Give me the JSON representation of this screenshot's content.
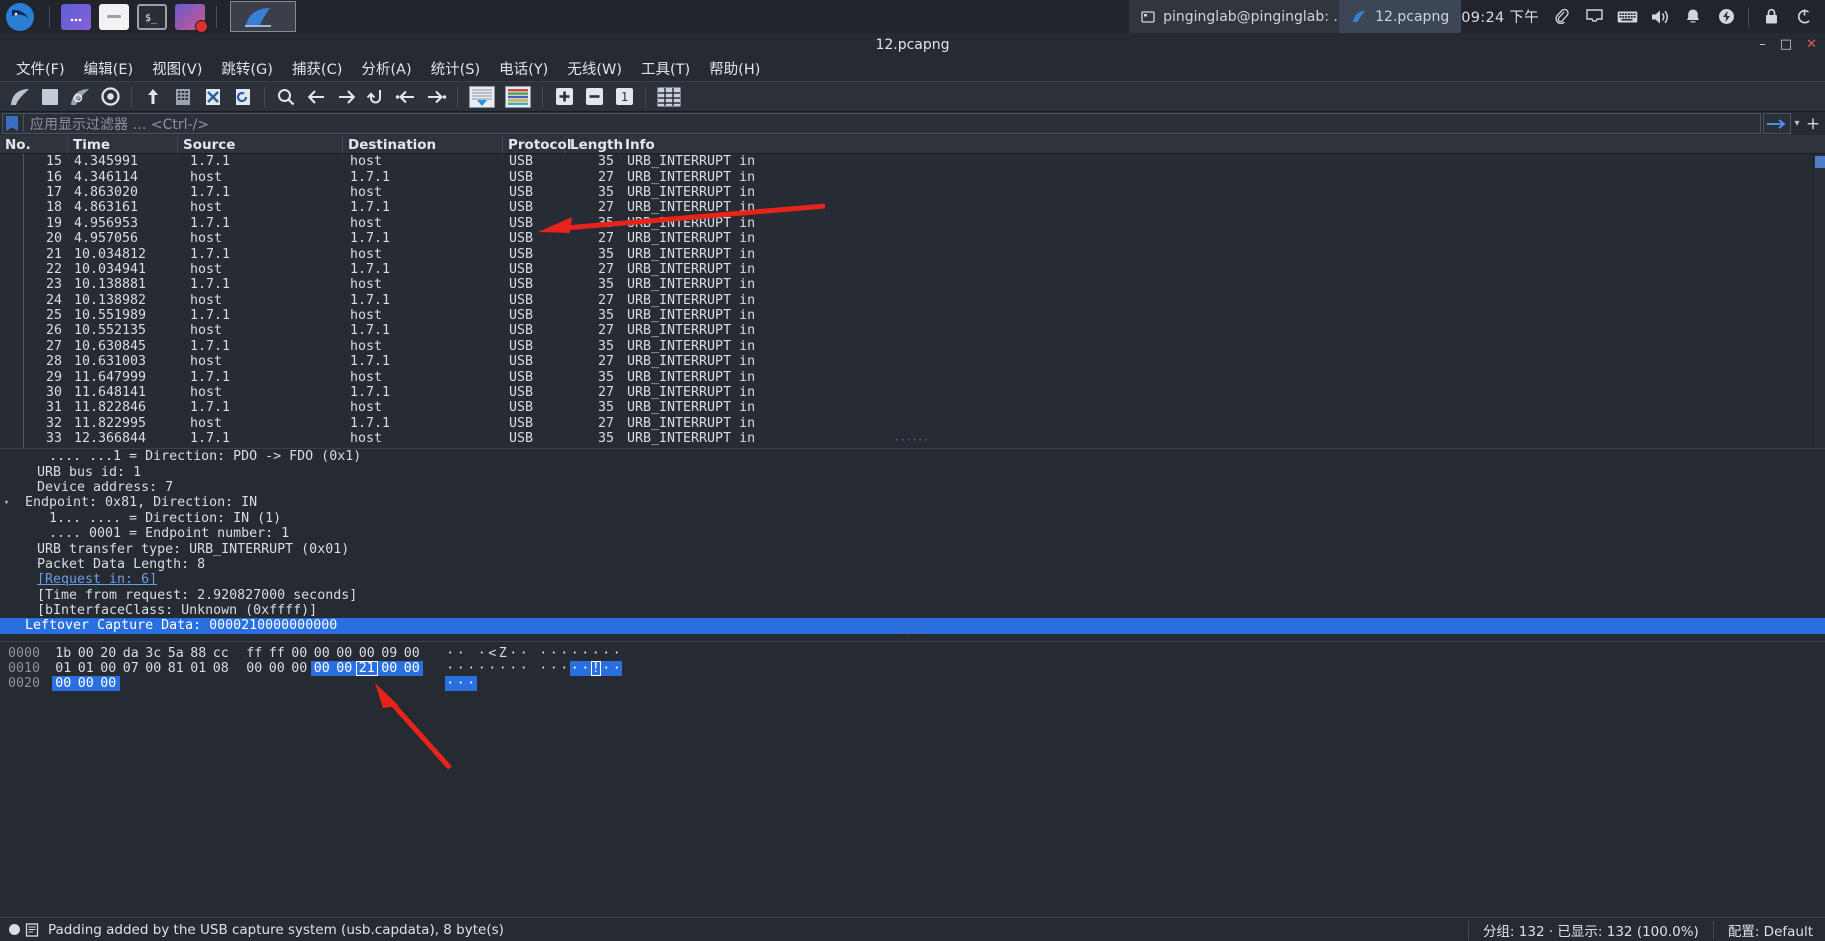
{
  "taskbar": {
    "launchers": [
      {
        "name": "kali-logo-icon"
      },
      {
        "name": "files-icon"
      },
      {
        "name": "folder-icon"
      },
      {
        "name": "terminal-icon"
      },
      {
        "name": "screen-recorder-icon"
      }
    ],
    "active_app": "wireshark-icon",
    "tasks": [
      {
        "label": "pinginglab@pinginglab: ...",
        "icon": "terminal-icon"
      },
      {
        "label": "12.pcapng",
        "icon": "wireshark-icon"
      }
    ],
    "clock": "09:24 下午",
    "tray": [
      {
        "name": "clipboard-icon",
        "glyph": "🖈"
      },
      {
        "name": "display-icon"
      },
      {
        "name": "keyboard-icon"
      },
      {
        "name": "volume-icon"
      },
      {
        "name": "notification-bell-icon"
      },
      {
        "name": "power-bolt-icon"
      },
      {
        "name": "lock-icon"
      },
      {
        "name": "logout-icon"
      }
    ]
  },
  "window": {
    "title": "12.pcapng",
    "minimize": "–",
    "maximize": "□",
    "close": "✕"
  },
  "menu": [
    {
      "label": "文件(F)",
      "key": "F"
    },
    {
      "label": "编辑(E)",
      "key": "E"
    },
    {
      "label": "视图(V)",
      "key": "V"
    },
    {
      "label": "跳转(G)",
      "key": "G"
    },
    {
      "label": "捕获(C)",
      "key": "C"
    },
    {
      "label": "分析(A)",
      "key": "A"
    },
    {
      "label": "统计(S)",
      "key": "S"
    },
    {
      "label": "电话(Y)",
      "key": "Y"
    },
    {
      "label": "无线(W)",
      "key": "W"
    },
    {
      "label": "工具(T)",
      "key": "T"
    },
    {
      "label": "帮助(H)",
      "key": "H"
    }
  ],
  "toolbar": [
    {
      "name": "start-capture-icon"
    },
    {
      "name": "stop-capture-icon"
    },
    {
      "name": "restart-capture-icon"
    },
    {
      "name": "capture-options-icon"
    },
    {
      "name": "open-file-icon"
    },
    {
      "name": "save-file-icon"
    },
    {
      "name": "close-file-icon"
    },
    {
      "name": "reload-file-icon"
    },
    {
      "name": "find-packet-icon"
    },
    {
      "name": "go-back-icon"
    },
    {
      "name": "go-forward-icon"
    },
    {
      "name": "go-to-packet-icon"
    },
    {
      "name": "go-to-first-packet-icon"
    },
    {
      "name": "go-to-last-packet-icon"
    },
    {
      "name": "auto-scroll-icon"
    },
    {
      "name": "colorize-icon"
    },
    {
      "name": "zoom-in-icon"
    },
    {
      "name": "zoom-out-icon"
    },
    {
      "name": "zoom-reset-icon"
    },
    {
      "name": "resize-columns-icon"
    }
  ],
  "filter": {
    "placeholder": "应用显示过滤器 … <Ctrl-/>",
    "value": "",
    "bookmark_icon": "filter-bookmark-icon",
    "apply_icon": "apply-filter-arrow-icon",
    "dropdown_icon": "chevron-down-icon",
    "add_icon": "add-filter-button"
  },
  "packet_list": {
    "columns": [
      "No.",
      "Time",
      "Source",
      "Destination",
      "Protocol",
      "Length",
      "Info"
    ],
    "rows": [
      {
        "no": "15",
        "time": "4.345991",
        "src": "1.7.1",
        "dst": "host",
        "proto": "USB",
        "len": "35",
        "info": "URB_INTERRUPT in"
      },
      {
        "no": "16",
        "time": "4.346114",
        "src": "host",
        "dst": "1.7.1",
        "proto": "USB",
        "len": "27",
        "info": "URB_INTERRUPT in"
      },
      {
        "no": "17",
        "time": "4.863020",
        "src": "1.7.1",
        "dst": "host",
        "proto": "USB",
        "len": "35",
        "info": "URB_INTERRUPT in"
      },
      {
        "no": "18",
        "time": "4.863161",
        "src": "host",
        "dst": "1.7.1",
        "proto": "USB",
        "len": "27",
        "info": "URB_INTERRUPT in"
      },
      {
        "no": "19",
        "time": "4.956953",
        "src": "1.7.1",
        "dst": "host",
        "proto": "USB",
        "len": "35",
        "info": "URB_INTERRUPT in"
      },
      {
        "no": "20",
        "time": "4.957056",
        "src": "host",
        "dst": "1.7.1",
        "proto": "USB",
        "len": "27",
        "info": "URB_INTERRUPT in"
      },
      {
        "no": "21",
        "time": "10.034812",
        "src": "1.7.1",
        "dst": "host",
        "proto": "USB",
        "len": "35",
        "info": "URB_INTERRUPT in"
      },
      {
        "no": "22",
        "time": "10.034941",
        "src": "host",
        "dst": "1.7.1",
        "proto": "USB",
        "len": "27",
        "info": "URB_INTERRUPT in"
      },
      {
        "no": "23",
        "time": "10.138881",
        "src": "1.7.1",
        "dst": "host",
        "proto": "USB",
        "len": "35",
        "info": "URB_INTERRUPT in"
      },
      {
        "no": "24",
        "time": "10.138982",
        "src": "host",
        "dst": "1.7.1",
        "proto": "USB",
        "len": "27",
        "info": "URB_INTERRUPT in"
      },
      {
        "no": "25",
        "time": "10.551989",
        "src": "1.7.1",
        "dst": "host",
        "proto": "USB",
        "len": "35",
        "info": "URB_INTERRUPT in"
      },
      {
        "no": "26",
        "time": "10.552135",
        "src": "host",
        "dst": "1.7.1",
        "proto": "USB",
        "len": "27",
        "info": "URB_INTERRUPT in"
      },
      {
        "no": "27",
        "time": "10.630845",
        "src": "1.7.1",
        "dst": "host",
        "proto": "USB",
        "len": "35",
        "info": "URB_INTERRUPT in"
      },
      {
        "no": "28",
        "time": "10.631003",
        "src": "host",
        "dst": "1.7.1",
        "proto": "USB",
        "len": "27",
        "info": "URB_INTERRUPT in"
      },
      {
        "no": "29",
        "time": "11.647999",
        "src": "1.7.1",
        "dst": "host",
        "proto": "USB",
        "len": "35",
        "info": "URB_INTERRUPT in"
      },
      {
        "no": "30",
        "time": "11.648141",
        "src": "host",
        "dst": "1.7.1",
        "proto": "USB",
        "len": "27",
        "info": "URB_INTERRUPT in"
      },
      {
        "no": "31",
        "time": "11.822846",
        "src": "1.7.1",
        "dst": "host",
        "proto": "USB",
        "len": "35",
        "info": "URB_INTERRUPT in"
      },
      {
        "no": "32",
        "time": "11.822995",
        "src": "host",
        "dst": "1.7.1",
        "proto": "USB",
        "len": "27",
        "info": "URB_INTERRUPT in"
      },
      {
        "no": "33",
        "time": "12.366844",
        "src": "1.7.1",
        "dst": "host",
        "proto": "USB",
        "len": "35",
        "info": "URB_INTERRUPT in"
      }
    ]
  },
  "packet_detail": {
    "rows": [
      {
        "indent": 3,
        "caret": "",
        "text": ".... ...1 = Direction: PDO -> FDO (0x1)",
        "style": "plain"
      },
      {
        "indent": 2,
        "caret": "",
        "text": "URB bus id: 1",
        "style": "plain"
      },
      {
        "indent": 2,
        "caret": "",
        "text": "Device address: 7",
        "style": "plain"
      },
      {
        "indent": 1,
        "caret": "▾",
        "text": "Endpoint: 0x81, Direction: IN",
        "style": "plain"
      },
      {
        "indent": 3,
        "caret": "",
        "text": "1... .... = Direction: IN (1)",
        "style": "plain"
      },
      {
        "indent": 3,
        "caret": "",
        "text": ".... 0001 = Endpoint number: 1",
        "style": "plain"
      },
      {
        "indent": 2,
        "caret": "",
        "text": "URB transfer type: URB_INTERRUPT (0x01)",
        "style": "plain"
      },
      {
        "indent": 2,
        "caret": "",
        "text": "Packet Data Length: 8",
        "style": "plain"
      },
      {
        "indent": 2,
        "caret": "",
        "text": "[Request in: 6]",
        "style": "link"
      },
      {
        "indent": 2,
        "caret": "",
        "text": "[Time from request: 2.920827000 seconds]",
        "style": "plain"
      },
      {
        "indent": 2,
        "caret": "",
        "text": "[bInterfaceClass: Unknown (0xffff)]",
        "style": "plain"
      },
      {
        "indent": 1,
        "caret": "",
        "text": "Leftover Capture Data: 0000210000000000",
        "style": "selected"
      }
    ]
  },
  "hex_dump": {
    "rows": [
      {
        "offset": "0000",
        "bytes": [
          "1b",
          "00",
          "20",
          "da",
          "3c",
          "5a",
          "88",
          "cc",
          "ff",
          "ff",
          "00",
          "00",
          "00",
          "00",
          "09",
          "00"
        ],
        "highlight": [],
        "cursor": -1,
        "ascii": [
          "·",
          "·",
          " ",
          "·",
          "<",
          "Z",
          "·",
          "·",
          "·",
          "·",
          "·",
          "·",
          "·",
          "·",
          "·",
          "·"
        ],
        "ascii_highlight": []
      },
      {
        "offset": "0010",
        "bytes": [
          "01",
          "01",
          "00",
          "07",
          "00",
          "81",
          "01",
          "08",
          "00",
          "00",
          "00",
          "00",
          "00",
          "21",
          "00",
          "00"
        ],
        "highlight": [
          11,
          12,
          14,
          15
        ],
        "cursor": 13,
        "ascii": [
          "·",
          "·",
          "·",
          "·",
          "·",
          "·",
          "·",
          "·",
          "·",
          "·",
          "·",
          "·",
          "·",
          "!",
          "·",
          "·"
        ],
        "ascii_highlight": [
          11,
          12,
          14,
          15
        ]
      },
      {
        "offset": "0020",
        "bytes": [
          "00",
          "00",
          "00"
        ],
        "highlight": [
          0,
          1,
          2
        ],
        "cursor": -1,
        "ascii": [
          "·",
          "·",
          "·"
        ],
        "ascii_highlight": [
          0,
          1,
          2
        ]
      }
    ]
  },
  "statusbar": {
    "expert_icon": "expert-info-icon",
    "left_text": "Padding added by the USB capture system (usb.capdata), 8 byte(s)",
    "middle_text": "分组: 132 · 已显示: 132 (100.0%)",
    "right_text": "配置: Default"
  },
  "colors": {
    "accent_blue": "#2a6fe0",
    "arrow_red": "#e8231c",
    "window_bg": "#262a31",
    "taskbar_bg": "#21242b",
    "link_blue": "#6c9ce8"
  }
}
